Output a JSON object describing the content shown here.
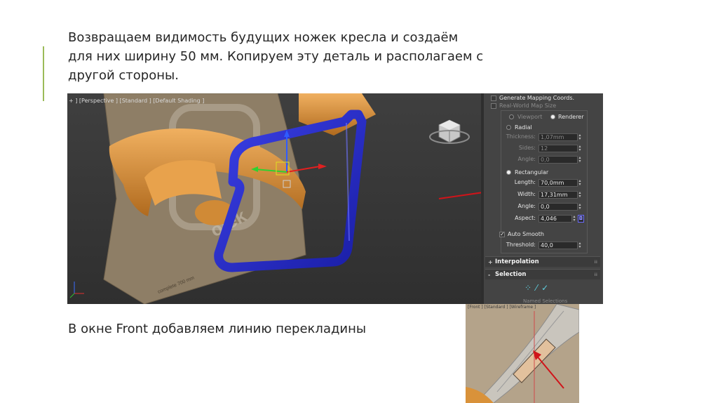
{
  "slide": {
    "paragraph1": [
      "Возвращаем видимость будущих ножек кресла и создаём",
      "для них ширину 50 мм. Копируем эту деталь и располагаем с",
      "другой стороны."
    ],
    "paragraph2": "В окне Front добавляем линию перекладины"
  },
  "viewport": {
    "label": "+ ] [Perspective ] [Standard ] [Default Shading ]",
    "floor_text": "complete 700 mm",
    "logo_text": "ofek"
  },
  "panel": {
    "generate_mapping": "Generate Mapping Coords.",
    "real_world": "Real-World Map Size",
    "viewport_opt": "Viewport",
    "renderer_opt": "Renderer",
    "radial": "Radial",
    "thickness_label": "Thickness:",
    "thickness_value": "1,07mm",
    "sides_label": "Sides:",
    "sides_value": "12",
    "angle_label_radial": "Angle:",
    "angle_value_radial": "0,0",
    "rectangular": "Rectangular",
    "length_label": "Length:",
    "length_value": "70,0mm",
    "width_label": "Width:",
    "width_value": "17,31mm",
    "angle_label": "Angle:",
    "angle_value": "0,0",
    "aspect_label": "Aspect:",
    "aspect_value": "4,046",
    "auto_smooth": "Auto Smooth",
    "threshold_label": "Threshold:",
    "threshold_value": "40,0",
    "interpolation": "Interpolation",
    "selection": "Selection",
    "named_selections": "Named Selections",
    "plus": "+",
    "minus": "-"
  },
  "front_view": {
    "label": "[Front ] [Standard ] [Wireframe ]"
  },
  "colors": {
    "accent": "#9bbb59",
    "text": "#262626",
    "arrow": "#d0141a",
    "blue_leg": "#2a2fd0",
    "orange_seat": "#e09a3c"
  }
}
